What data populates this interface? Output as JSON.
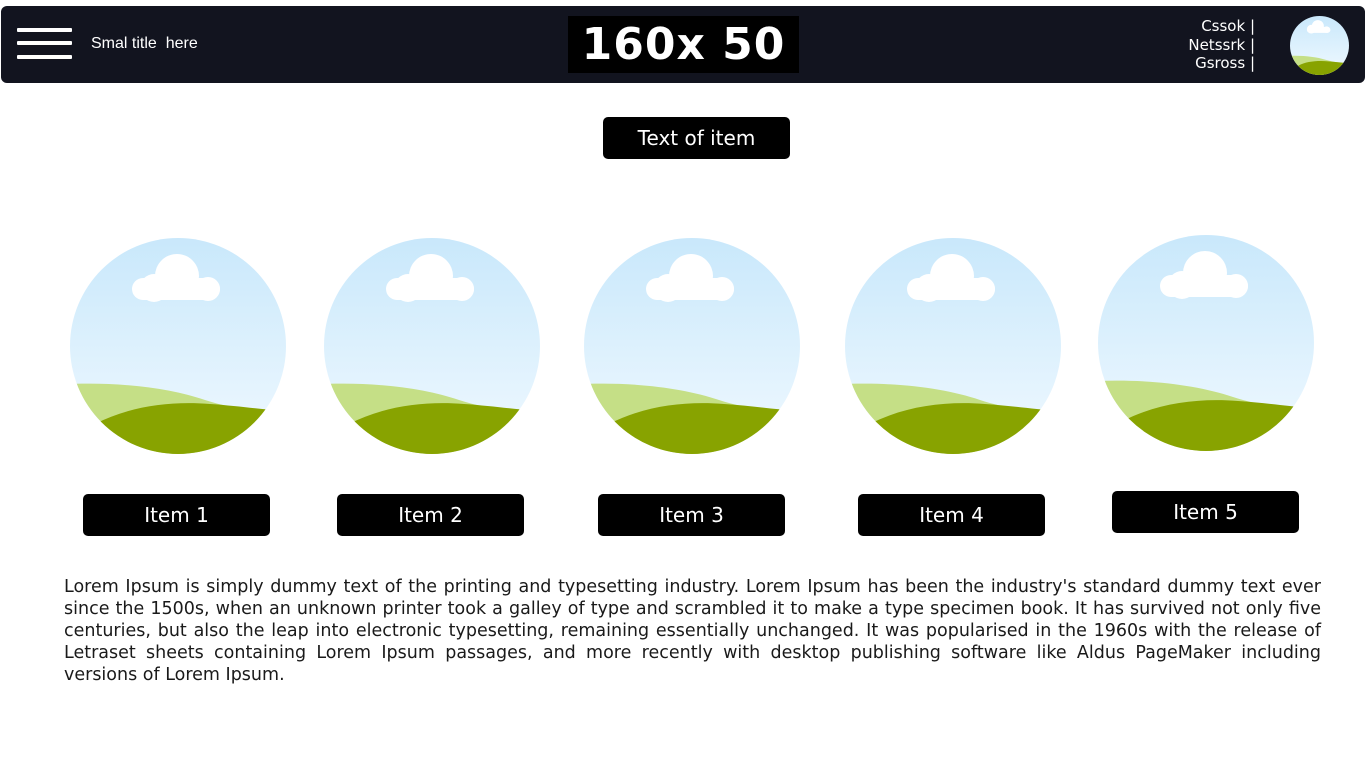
{
  "header": {
    "small_title": "Smal title  here",
    "logo_text": "160x 50",
    "nav_links": [
      "Cssok |",
      "Netssrk |",
      "Gsross |"
    ]
  },
  "main": {
    "top_button_label": "Text of item",
    "items": [
      {
        "label": "Item 1"
      },
      {
        "label": "Item 2"
      },
      {
        "label": "Item 3"
      },
      {
        "label": "Item 4"
      },
      {
        "label": "Item 5"
      }
    ],
    "paragraph": "Lorem Ipsum is simply dummy text of the printing and typesetting industry. Lorem Ipsum has been the industry's standard dummy text ever since the 1500s, when an unknown printer took a galley of type and scrambled it to make a type specimen book. It has survived not only five centuries, but also the leap into electronic typesetting, remaining essentially unchanged. It was popularised in the 1960s with the release of Letraset sheets containing Lorem Ipsum passages, and more recently with desktop publishing software like Aldus PageMaker including versions of Lorem Ipsum."
  },
  "icons": {
    "menu": "hamburger-menu-icon",
    "avatar": "landscape-image-placeholder",
    "item_image": "landscape-image-placeholder"
  },
  "colors": {
    "header_bg": "#12141f",
    "button_bg": "#000000",
    "sky_top": "#c9e8fb",
    "sky_bottom": "#eef8fe",
    "hill_light": "#c5df86",
    "hill_dark": "#88a300"
  }
}
